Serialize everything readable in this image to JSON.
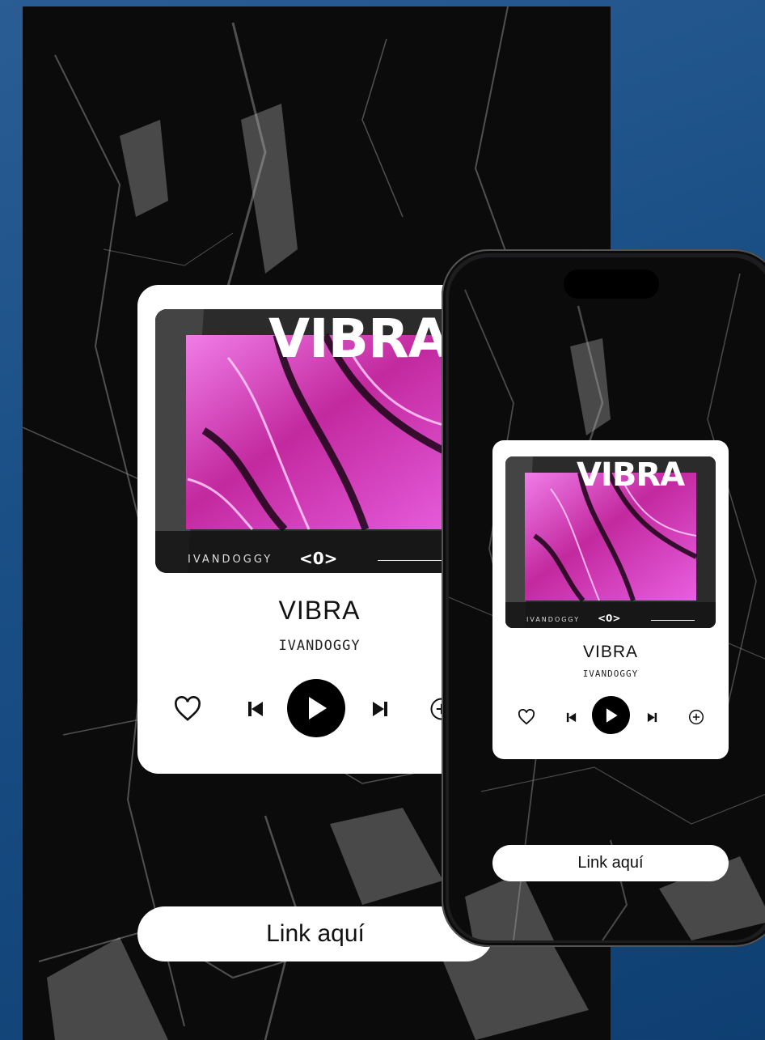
{
  "big_player": {
    "album_title": "VIBRA",
    "strip_artist": "IVANDOGGY",
    "strip_logo": "<0>",
    "song_title": "VIBRA",
    "artist": "IVANDOGGY",
    "link_label": "Link aquí"
  },
  "small_player": {
    "album_title": "VIBRA",
    "strip_artist": "IVANDOGGY",
    "strip_logo": "<0>",
    "song_title": "VIBRA",
    "artist": "IVANDOGGY",
    "link_label": "Link aquí"
  },
  "icons": [
    "heart-icon",
    "skip-back-icon",
    "play-icon",
    "skip-forward-icon",
    "add-circle-icon"
  ],
  "colors": {
    "background": "#1a4f86",
    "marble": "#0b0b0b",
    "accent_pink": "#d23fd0",
    "card": "#ffffff",
    "play_button": "#000000"
  }
}
